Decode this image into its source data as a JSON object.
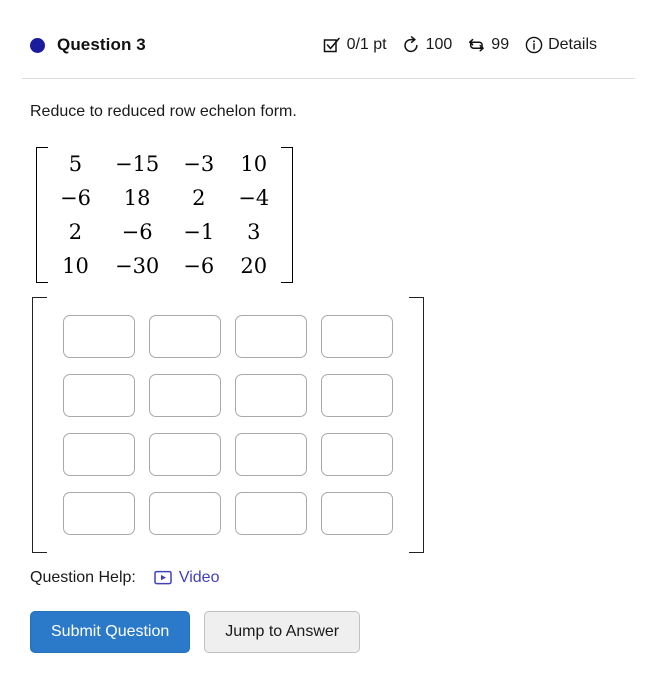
{
  "header": {
    "status_dot_color": "#1b1b9e",
    "title": "Question 3",
    "score": "0/1 pt",
    "score_icon": "checkbox-checked-icon",
    "attempts": "100",
    "attempts_icon": "undo-arrow-icon",
    "retries": "99",
    "retries_icon": "swap-arrows-icon",
    "details_label": "Details",
    "details_icon": "info-circle-icon"
  },
  "prompt": {
    "text": "Reduce to reduced row echelon form."
  },
  "given_matrix": {
    "rows": [
      [
        "5",
        "−15",
        "−3",
        "10"
      ],
      [
        "−6",
        "18",
        "2",
        "−4"
      ],
      [
        "2",
        "−6",
        "−1",
        "3"
      ],
      [
        "10",
        "−30",
        "−6",
        "20"
      ]
    ]
  },
  "answer_matrix": {
    "rows": 4,
    "cols": 4,
    "values": [
      [
        "",
        "",
        "",
        ""
      ],
      [
        "",
        "",
        "",
        ""
      ],
      [
        "",
        "",
        "",
        ""
      ],
      [
        "",
        "",
        "",
        ""
      ]
    ],
    "placeholder": ""
  },
  "help": {
    "label": "Question Help:",
    "video_label": "Video",
    "video_icon": "video-play-icon",
    "link_color": "#4040c0"
  },
  "actions": {
    "submit_label": "Submit Question",
    "jump_label": "Jump to Answer",
    "submit_color": "#2b7ac9"
  }
}
